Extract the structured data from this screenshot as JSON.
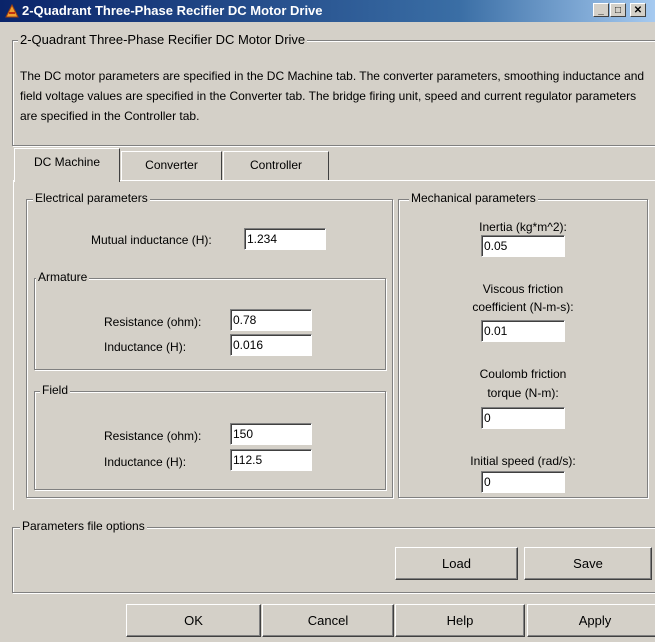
{
  "window": {
    "title": "2-Quadrant Three-Phase Recifier DC Motor Drive",
    "buttons": {
      "minimize": "_",
      "maximize": "□",
      "close": "✕"
    }
  },
  "description": {
    "group_title": "2-Quadrant Three-Phase Recifier DC Motor Drive",
    "text": "The DC motor parameters are specified in the DC Machine tab. The converter parameters, smoothing inductance and field voltage values are specified in the Converter tab. The bridge firing unit, speed and current regulator parameters are specified in the Controller tab."
  },
  "tabs": [
    {
      "label": "DC Machine",
      "active": true
    },
    {
      "label": "Converter",
      "active": false
    },
    {
      "label": "Controller",
      "active": false
    }
  ],
  "electrical": {
    "title": "Electrical parameters",
    "mutual_label": "Mutual inductance (H):",
    "mutual_value": "1.234",
    "armature": {
      "title": "Armature",
      "resistance_label": "Resistance (ohm):",
      "resistance_value": "0.78",
      "inductance_label": "Inductance (H):",
      "inductance_value": "0.016"
    },
    "field": {
      "title": "Field",
      "resistance_label": "Resistance (ohm):",
      "resistance_value": "150",
      "inductance_label": "Inductance (H):",
      "inductance_value": "112.5"
    }
  },
  "mechanical": {
    "title": "Mechanical parameters",
    "inertia_label": "Inertia (kg*m^2):",
    "inertia_value": "0.05",
    "viscous_label_1": "Viscous friction",
    "viscous_label_2": "coefficient (N-m-s):",
    "viscous_value": "0.01",
    "coulomb_label_1": "Coulomb friction",
    "coulomb_label_2": "torque (N-m):",
    "coulomb_value": "0",
    "speed_label": "Initial speed (rad/s):",
    "speed_value": "0"
  },
  "params_file": {
    "title": "Parameters file options",
    "load": "Load",
    "save": "Save"
  },
  "footer": {
    "ok": "OK",
    "cancel": "Cancel",
    "help": "Help",
    "apply": "Apply"
  }
}
